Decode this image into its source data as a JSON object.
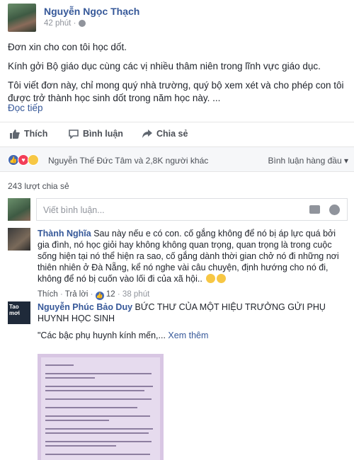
{
  "post": {
    "author": "Nguyễn Ngọc Thạch",
    "time": "42 phút ·",
    "body": {
      "title_line": "Đơn xin cho con tôi học dốt.",
      "greeting": "Kính gởi Bộ giáo dục cùng các vị nhiều thâm niên trong lĩnh vực giáo dục.",
      "paragraph": "Tôi viết đơn này, chỉ mong quý nhà trường, quý bộ xem xét và cho phép con tôi được trở thành học sinh dốt trong năm học này. ..."
    },
    "read_more": "Đọc tiếp",
    "actions": {
      "like": "Thích",
      "comment": "Bình luận",
      "share": "Chia sẻ"
    },
    "reactions": {
      "summary": "Nguyễn Thế Đức Tâm và 2,8K người khác",
      "sort": "Bình luận hàng đầu ▾"
    },
    "shares": "243 lượt chia sẻ"
  },
  "composer": {
    "placeholder": "Viết bình luận..."
  },
  "comments": [
    {
      "name": "Thành Nghĩa",
      "text": "Sau này nếu e có con. cố gắng không để nó bị áp lực quá bởi gia đình, nó học giỏi hay không không quan trọng, quan trọng là trong cuộc sống hiện tại nó thể hiện ra sao, cố gắng dành thời gian chở nó đi những nơi thiên nhiên ở Đà Nẵng, kể nó nghe vài câu chuyện, định hướng cho nó đi, không để nó bị cuốn vào lối đi của xã hội..",
      "like": "Thích",
      "reply": "Trả lời",
      "likes": "12",
      "time": "38 phút"
    },
    {
      "name": "Nguyễn Phúc Bảo Duy",
      "text": "BỨC THƯ CỦA MỘT HIỆU TRƯỞNG GỬI PHỤ HUYNH HỌC SINH",
      "quote": "\"Các bậc phụ huynh kính mến,...",
      "see_more": "Xem thêm",
      "avatar_text": "Tao mơi"
    }
  ]
}
